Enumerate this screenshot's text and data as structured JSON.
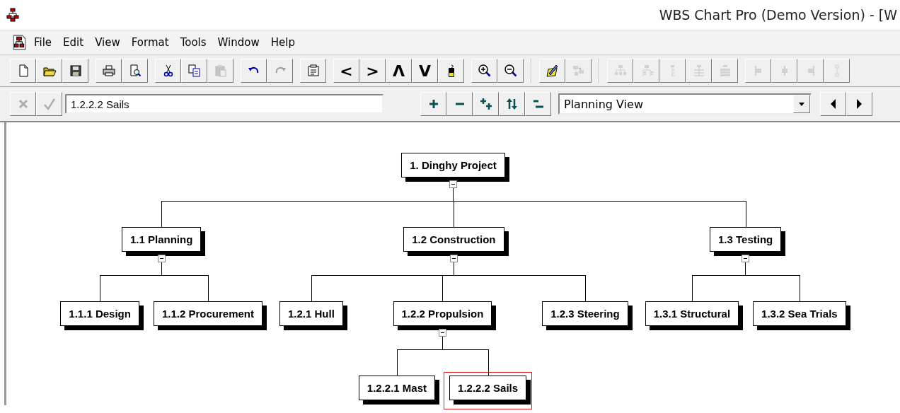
{
  "window": {
    "title": "WBS Chart Pro (Demo Version) - [W"
  },
  "menu": [
    "File",
    "Edit",
    "View",
    "Format",
    "Tools",
    "Window",
    "Help"
  ],
  "toolbar": [
    [
      {
        "kind": "new",
        "disabled": false
      },
      {
        "kind": "open",
        "disabled": false
      },
      {
        "kind": "save",
        "disabled": false
      }
    ],
    [
      {
        "kind": "print",
        "disabled": false
      },
      {
        "kind": "preview",
        "disabled": false
      }
    ],
    [
      {
        "kind": "cut",
        "disabled": false
      },
      {
        "kind": "copy",
        "disabled": false
      },
      {
        "kind": "paste",
        "disabled": true
      }
    ],
    [
      {
        "kind": "undo",
        "disabled": false
      },
      {
        "kind": "redo",
        "disabled": true
      }
    ],
    [
      {
        "kind": "notes",
        "disabled": false
      }
    ],
    [
      {
        "kind": "move_left",
        "label": "<",
        "disabled": false
      },
      {
        "kind": "move_right",
        "label": ">",
        "disabled": false
      },
      {
        "kind": "move_up",
        "label": "Λ",
        "disabled": false
      },
      {
        "kind": "move_down",
        "label": "V",
        "disabled": false
      },
      {
        "kind": "canister",
        "disabled": false
      }
    ],
    [
      {
        "kind": "zoom_in",
        "disabled": false
      },
      {
        "kind": "zoom_out",
        "disabled": false
      }
    ],
    [
      {
        "kind": "pen_pad",
        "disabled": false
      },
      {
        "kind": "linked_boxes",
        "disabled": true
      }
    ],
    [
      {
        "kind": "org_layout",
        "disabled": true
      },
      {
        "kind": "org_list_layout",
        "disabled": true
      },
      {
        "kind": "list_layout",
        "disabled": true
      },
      {
        "kind": "mixed_layout",
        "disabled": true
      },
      {
        "kind": "stack_layout",
        "disabled": true
      }
    ],
    [
      {
        "kind": "align_left",
        "disabled": true
      },
      {
        "kind": "align_center",
        "disabled": true
      },
      {
        "kind": "align_right",
        "disabled": true
      },
      {
        "kind": "align_span",
        "disabled": true
      }
    ]
  ],
  "edit_bar": {
    "cancel": {
      "disabled": true
    },
    "accept": {
      "disabled": true
    },
    "field_value": "1.2.2.2 Sails",
    "outline_buttons": [
      {
        "kind": "add"
      },
      {
        "kind": "remove"
      },
      {
        "kind": "add_level"
      },
      {
        "kind": "swap"
      },
      {
        "kind": "collapse"
      }
    ],
    "view": {
      "value": "Planning View"
    },
    "nav": [
      {
        "kind": "prev"
      },
      {
        "kind": "next"
      }
    ]
  },
  "chart": {
    "root": {
      "label": "1. Dinghy Project",
      "selected": false,
      "expanded": true,
      "children": [
        {
          "label": "1.1 Planning",
          "selected": false,
          "expanded": true,
          "children": [
            {
              "label": "1.1.1 Design",
              "selected": false
            },
            {
              "label": "1.1.2 Procurement",
              "selected": false
            }
          ]
        },
        {
          "label": "1.2 Construction",
          "selected": false,
          "expanded": true,
          "children": [
            {
              "label": "1.2.1 Hull",
              "selected": false
            },
            {
              "label": "1.2.2 Propulsion",
              "selected": false,
              "expanded": true,
              "children": [
                {
                  "label": "1.2.2.1 Mast",
                  "selected": false
                },
                {
                  "label": "1.2.2.2 Sails",
                  "selected": true
                }
              ]
            },
            {
              "label": "1.2.3 Steering",
              "selected": false
            }
          ]
        },
        {
          "label": "1.3 Testing",
          "selected": false,
          "expanded": true,
          "children": [
            {
              "label": "1.3.1 Structural",
              "selected": false
            },
            {
              "label": "1.3.2 Sea Trials",
              "selected": false
            }
          ]
        }
      ]
    }
  }
}
